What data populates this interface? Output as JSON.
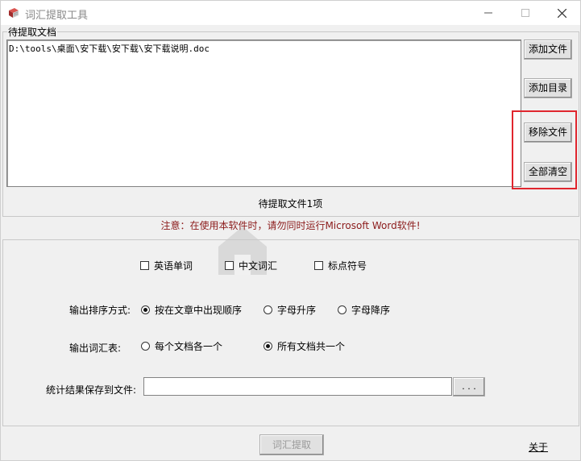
{
  "window": {
    "title": "词汇提取工具",
    "minimize_icon": "minimize-icon",
    "maximize_icon": "maximize-icon",
    "close_icon": "close-icon"
  },
  "files_group": {
    "label": "待提取文档",
    "files": [
      "D:\\tools\\桌面\\安下载\\安下载\\安下载说明.doc"
    ],
    "buttons": {
      "add_file": "添加文件",
      "add_dir": "添加目录",
      "remove_file": "移除文件",
      "clear_all": "全部清空"
    },
    "highlight_color": "#e0262e",
    "count_text": "待提取文件1项"
  },
  "warning": {
    "text": "注意：在使用本软件时，请勿同时运行Microsoft Word软件!",
    "color": "#8b1a1a"
  },
  "options": {
    "checkboxes": [
      {
        "label": "英语单词",
        "checked": false
      },
      {
        "label": "中文词汇",
        "checked": false
      },
      {
        "label": "标点符号",
        "checked": false
      }
    ],
    "sort_label": "输出排序方式:",
    "sort_options": [
      {
        "label": "按在文章中出现顺序",
        "selected": true
      },
      {
        "label": "字母升序",
        "selected": false
      },
      {
        "label": "字母降序",
        "selected": false
      }
    ],
    "output_label": "输出词汇表:",
    "output_options": [
      {
        "label": "每个文档各一个",
        "selected": false
      },
      {
        "label": "所有文档共一个",
        "selected": true
      }
    ],
    "save_label": "统计结果保存到文件:",
    "save_value": "",
    "browse_label": ". . ."
  },
  "footer": {
    "extract_label": "词汇提取",
    "about_label": "关于"
  }
}
